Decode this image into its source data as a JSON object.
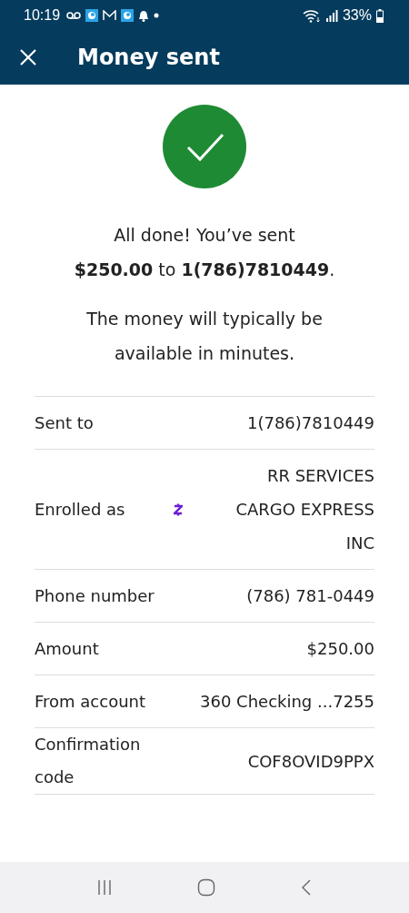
{
  "status_bar": {
    "time": "10:19",
    "battery": "33%"
  },
  "header": {
    "title": "Money sent"
  },
  "messages": [
    "All done! You’ve sent **$250.00** to **1(786)7810449**.",
    "The money will typically be available in minutes."
  ],
  "details": [
    {
      "kind": "plain",
      "label": "Sent to",
      "value": "1(786)7810449"
    },
    {
      "kind": "zelle",
      "label": "Enrolled as",
      "value": "RR SERVICES CARGO EXPRESS INC"
    },
    {
      "kind": "plain",
      "label": "Phone number",
      "value": "(786) 781-0449"
    },
    {
      "kind": "plain",
      "label": "Amount",
      "value": "$250.00"
    },
    {
      "kind": "plain",
      "label": "From account",
      "value": "360 Checking ...7255"
    },
    {
      "kind": "plain",
      "label": "Confirmation code",
      "value": "COF8OVID9PPX"
    }
  ]
}
